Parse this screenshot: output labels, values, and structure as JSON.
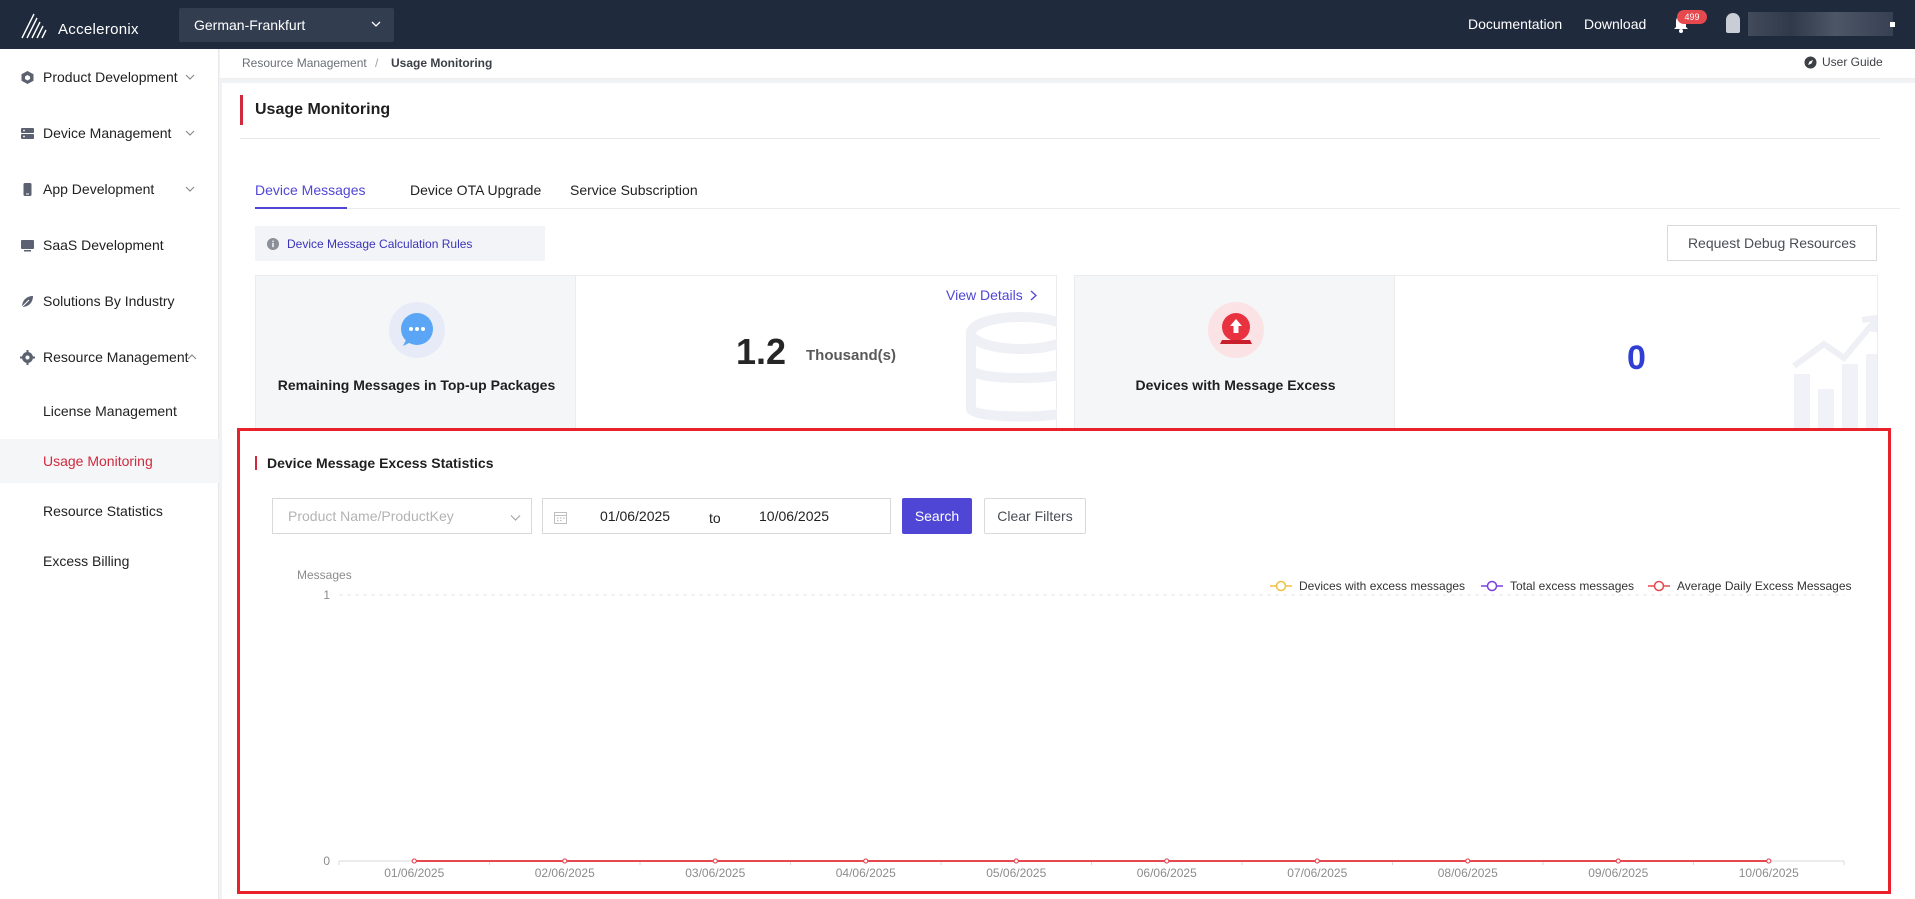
{
  "app": {
    "logo_text": "Acceleronix",
    "region": "German-Frankfurt",
    "documentation_label": "Documentation",
    "download_label": "Download",
    "notification_count": "499"
  },
  "sidebar": {
    "items": [
      {
        "label": "Product Development",
        "icon": "cube-icon"
      },
      {
        "label": "Device Management",
        "icon": "server-icon"
      },
      {
        "label": "App Development",
        "icon": "phone-icon"
      },
      {
        "label": "SaaS Development",
        "icon": "monitor-icon"
      },
      {
        "label": "Solutions By Industry",
        "icon": "leaf-icon"
      },
      {
        "label": "Resource Management",
        "icon": "gear-icon"
      }
    ],
    "sub_items": [
      {
        "label": "License Management"
      },
      {
        "label": "Usage Monitoring"
      },
      {
        "label": "Resource Statistics"
      },
      {
        "label": "Excess Billing"
      }
    ]
  },
  "breadcrumb": {
    "parent": "Resource Management",
    "separator": "/",
    "current": "Usage Monitoring",
    "user_guide": "User Guide"
  },
  "main": {
    "title": "Usage Monitoring",
    "tabs": [
      {
        "label": "Device Messages",
        "active": true
      },
      {
        "label": "Device OTA Upgrade",
        "active": false
      },
      {
        "label": "Service Subscription",
        "active": false
      }
    ],
    "rules_link": "Device Message Calculation Rules",
    "debug_button": "Request Debug Resources",
    "cards": {
      "remaining": {
        "caption": "Remaining Messages in Top-up Packages",
        "value": "1.2",
        "unit": "Thousand(s)",
        "view_details": "View Details"
      },
      "excess": {
        "caption": "Devices with Message Excess",
        "value": "0"
      }
    }
  },
  "stats": {
    "title": "Device Message Excess Statistics",
    "product_placeholder": "Product Name/ProductKey",
    "date_from": "01/06/2025",
    "date_to_label": "to",
    "date_end": "10/06/2025",
    "search_label": "Search",
    "clear_label": "Clear Filters"
  },
  "colors": {
    "accent": "#4f46d6",
    "brand_red": "#d1293d",
    "series_devices": "#f0c040",
    "series_total": "#7b3fe0",
    "series_average": "#e5484d"
  },
  "chart_data": {
    "type": "line",
    "ylabel": "Messages",
    "ylim": [
      0,
      1
    ],
    "y_ticks": [
      "0",
      "1"
    ],
    "categories": [
      "01/06/2025",
      "02/06/2025",
      "03/06/2025",
      "04/06/2025",
      "05/06/2025",
      "06/06/2025",
      "07/06/2025",
      "08/06/2025",
      "09/06/2025",
      "10/06/2025"
    ],
    "series": [
      {
        "name": "Devices with excess messages",
        "values": [
          0,
          0,
          0,
          0,
          0,
          0,
          0,
          0,
          0,
          0
        ]
      },
      {
        "name": "Total excess messages",
        "values": [
          0,
          0,
          0,
          0,
          0,
          0,
          0,
          0,
          0,
          0
        ]
      },
      {
        "name": "Average Daily Excess Messages",
        "values": [
          0,
          0,
          0,
          0,
          0,
          0,
          0,
          0,
          0,
          0
        ]
      }
    ],
    "legend": "top-right",
    "grid": true
  }
}
